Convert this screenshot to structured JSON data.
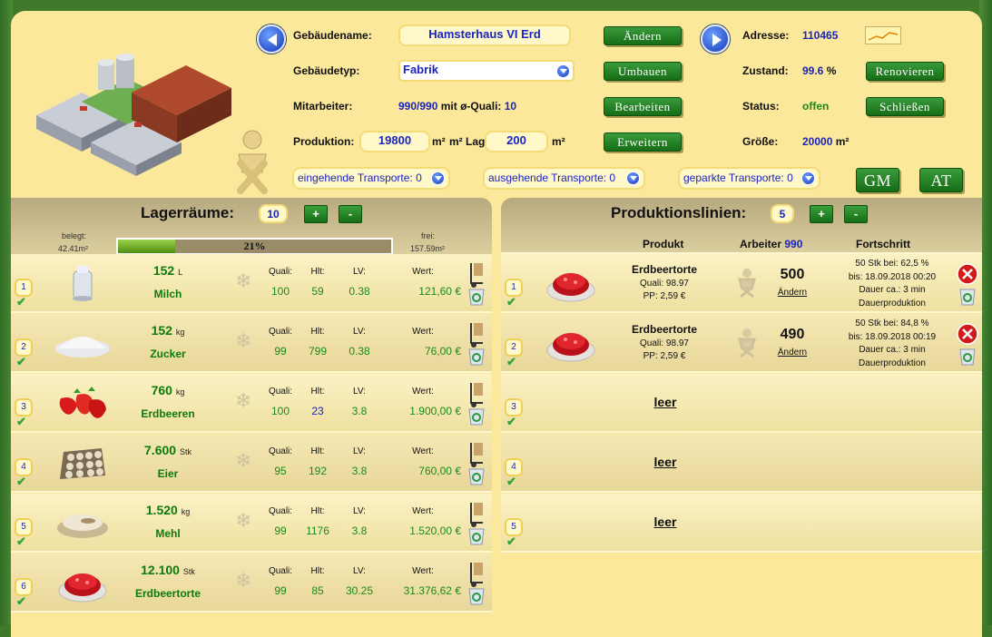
{
  "building": {
    "name_label": "Gebäudename:",
    "name": "Hamsterhaus VI Erd",
    "change_btn": "Ändern",
    "address_label": "Adresse:",
    "address": "110465",
    "type_label": "Gebäudetyp:",
    "type": "Fabrik",
    "rebuild_btn": "Umbauen",
    "state_label": "Zustand:",
    "state_val": "99.6",
    "state_unit": "%",
    "renovate_btn": "Renovieren",
    "staff_label": "Mitarbeiter:",
    "staff": "990/990",
    "staff_mid": "mit ø-Quali:",
    "staff_quali": "10",
    "edit_btn": "Bearbeiten",
    "status_label": "Status:",
    "status": "offen",
    "close_btn": "Schließen",
    "prod_label": "Produktion:",
    "prod_val": "19800",
    "prod_unit": "m²",
    "storage_label": "m² Lager:",
    "storage_val": "200",
    "storage_unit": "m²",
    "expand_btn": "Erweitern",
    "size_label": "Größe:",
    "size_val": "20000",
    "size_unit": "m²",
    "transport_in": "eingehende Transporte: 0",
    "transport_out": "ausgehende Transporte: 0",
    "transport_park": "geparkte Transporte: 0",
    "gm_btn": "GM",
    "at_btn": "AT"
  },
  "storage": {
    "title": "Lagerräume:",
    "count": "10",
    "plus": "+",
    "minus": "-",
    "used_label": "belegt:",
    "used": "42.41m²",
    "free_label": "frei:",
    "free": "157.59m²",
    "fill_pct": "21%",
    "fill_fraction": 0.21,
    "col_quali": "Quali:",
    "col_hlt": "Hlt:",
    "col_lv": "LV:",
    "col_wert": "Wert:",
    "rows": [
      {
        "idx": "1",
        "qty": "152",
        "unit": "L",
        "name": "Milch",
        "quali": "100",
        "hlt": "59",
        "lv": "0.38",
        "wert": "121,60 €"
      },
      {
        "idx": "2",
        "qty": "152",
        "unit": "kg",
        "name": "Zucker",
        "quali": "99",
        "hlt": "799",
        "lv": "0.38",
        "wert": "76,00 €"
      },
      {
        "idx": "3",
        "qty": "760",
        "unit": "kg",
        "name": "Erdbeeren",
        "quali": "100",
        "hlt": "23",
        "lv": "3.8",
        "wert": "1.900,00 €"
      },
      {
        "idx": "4",
        "qty": "7.600",
        "unit": "Stk",
        "name": "Eier",
        "quali": "95",
        "hlt": "192",
        "lv": "3.8",
        "wert": "760,00 €"
      },
      {
        "idx": "5",
        "qty": "1.520",
        "unit": "kg",
        "name": "Mehl",
        "quali": "99",
        "hlt": "1176",
        "lv": "3.8",
        "wert": "1.520,00 €"
      },
      {
        "idx": "6",
        "qty": "12.100",
        "unit": "Stk",
        "name": "Erdbeertorte",
        "quali": "99",
        "hlt": "85",
        "lv": "30.25",
        "wert": "31.376,62 €"
      }
    ]
  },
  "production": {
    "title": "Produktionslinien:",
    "count": "5",
    "plus": "+",
    "minus": "-",
    "col_product": "Produkt",
    "col_workers": "Arbeiter",
    "workers": "990",
    "col_progress": "Fortschritt",
    "lines": [
      {
        "idx": "1",
        "product": "Erdbeertorte",
        "quali": "Quali: 98.97",
        "pp": "PP: 2,59 €",
        "amount": "500",
        "change": "Ändern",
        "p1": "50 Stk bei: 62,5 %",
        "p2": "bis: 18.09.2018 00:20",
        "p3": "Dauer ca.: 3 min",
        "p4": "Dauerproduktion"
      },
      {
        "idx": "2",
        "product": "Erdbeertorte",
        "quali": "Quali: 98.97",
        "pp": "PP: 2,59 €",
        "amount": "490",
        "change": "Ändern",
        "p1": "50 Stk bei: 84,8 %",
        "p2": "bis: 18.09.2018 00:19",
        "p3": "Dauer ca.: 3 min",
        "p4": "Dauerproduktion"
      }
    ],
    "empty": [
      {
        "idx": "3",
        "text": "leer"
      },
      {
        "idx": "4",
        "text": "leer"
      },
      {
        "idx": "5",
        "text": "leer"
      }
    ]
  }
}
